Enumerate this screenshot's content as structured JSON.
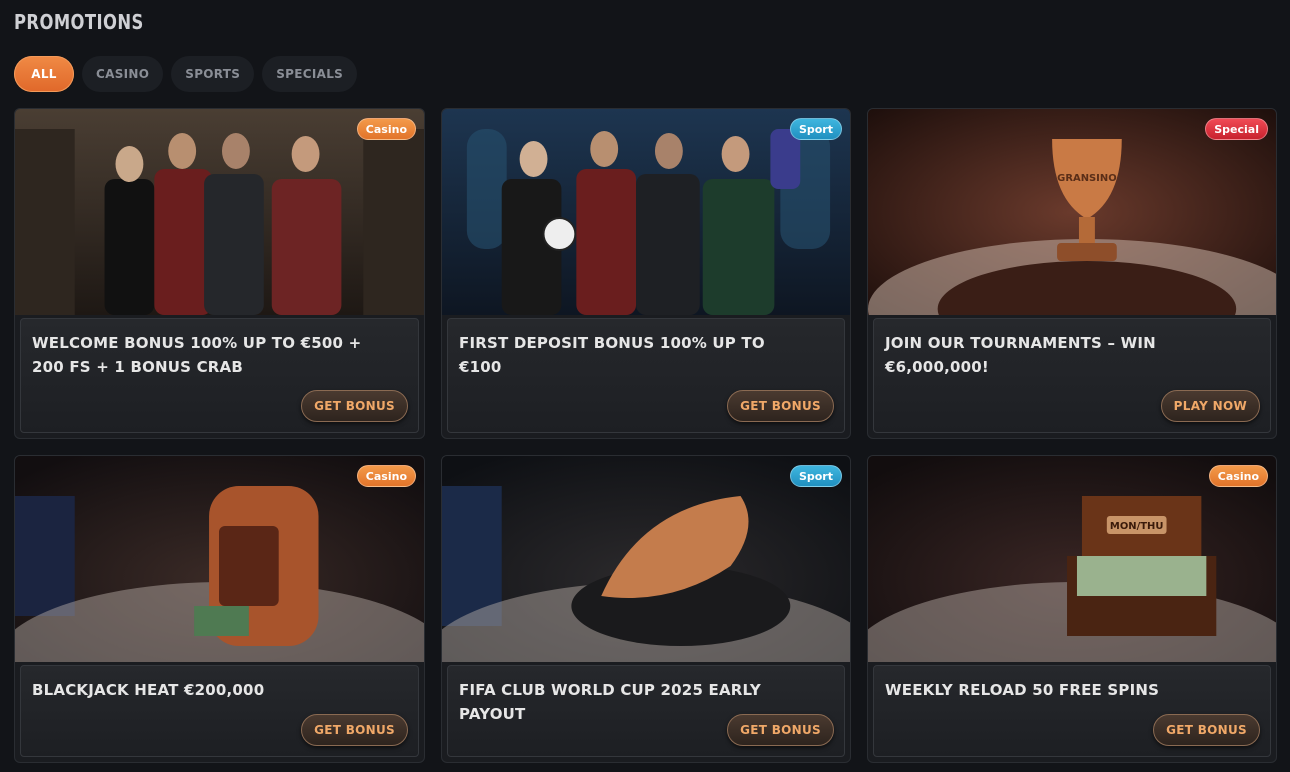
{
  "page_title": "PROMOTIONS",
  "filters": [
    {
      "label": "ALL",
      "active": true
    },
    {
      "label": "CASINO",
      "active": false
    },
    {
      "label": "SPORTS",
      "active": false
    },
    {
      "label": "SPECIALS",
      "active": false
    }
  ],
  "colors": {
    "accent": "#e8742f",
    "badge_casino": "#ef8a3c",
    "badge_sport": "#2ea4d2",
    "badge_special": "#e0333e",
    "cta_text": "#f0a868"
  },
  "promotions": [
    {
      "badge": "Casino",
      "title": "WELCOME BONUS 100% UP TO €500 + 200 FS + 1 BONUS CRAB",
      "cta": "GET BONUS",
      "art": "characters-casino"
    },
    {
      "badge": "Sport",
      "title": "FIRST DEPOSIT BONUS 100% UP TO €100",
      "cta": "GET BONUS",
      "art": "characters-sport"
    },
    {
      "badge": "Special",
      "title": "JOIN OUR TOURNAMENTS – WIN €6,000,000!",
      "cta": "PLAY NOW",
      "art": "trophy-icon"
    },
    {
      "badge": "Casino",
      "title": "BLACKJACK HEAT €200,000",
      "cta": "GET BONUS",
      "art": "slot-machine-icon"
    },
    {
      "badge": "Sport",
      "title": "FIFA CLUB WORLD CUP 2025 EARLY PAYOUT",
      "cta": "GET BONUS",
      "art": "boot-icon"
    },
    {
      "badge": "Casino",
      "title": "WEEKLY RELOAD 50 FREE SPINS",
      "cta": "GET BONUS",
      "art": "money-chest-icon"
    }
  ],
  "art_texts": {
    "chest_label": "MON/THU",
    "brand": "GRANSINO"
  }
}
